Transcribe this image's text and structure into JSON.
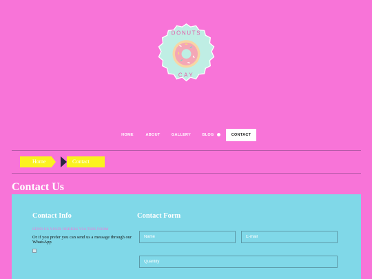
{
  "logo": {
    "top_text": "DONUTS",
    "bottom_text": "CAY"
  },
  "nav": {
    "items": [
      {
        "label": "HOME"
      },
      {
        "label": "ABOUT"
      },
      {
        "label": "GALLERY"
      },
      {
        "label": "BLOG"
      },
      {
        "label": "CONTACT"
      }
    ],
    "active": "CONTACT"
  },
  "breadcrumb": {
    "home": "Home",
    "current": "Contact"
  },
  "page": {
    "title": "Contact Us"
  },
  "contact_info": {
    "title": "Contact Info",
    "link_text": "SEND US YOUR ORDERS VIA THIS FORM",
    "text": "Or if you prefer you can send us a message through our WhatsApp"
  },
  "contact_form": {
    "title": "Contact Form",
    "name_placeholder": "Name",
    "email_placeholder": "E-mail",
    "quantity_placeholder": "Quantity"
  },
  "colors": {
    "background": "#f874d8",
    "panel": "#80d8e8",
    "breadcrumb": "#fbf21f",
    "donut_badge": "#bfeee4"
  }
}
